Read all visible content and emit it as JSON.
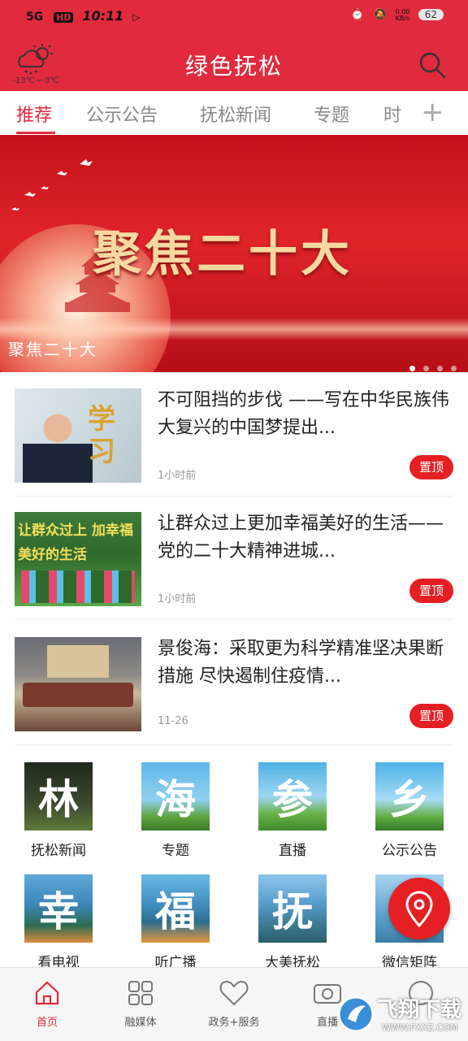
{
  "status_bar": {
    "network": "5G",
    "hd": "HD",
    "time": "10:11",
    "speed": "0.00\nKB/s",
    "battery": "62"
  },
  "header": {
    "title": "绿色抚松",
    "weather_temp": "-13℃~-3℃"
  },
  "tabs": [
    {
      "label": "推荐",
      "active": true
    },
    {
      "label": "公示公告",
      "active": false
    },
    {
      "label": "抚松新闻",
      "active": false
    },
    {
      "label": "专题",
      "active": false
    },
    {
      "label": "时",
      "active": false
    }
  ],
  "banner": {
    "headline": "聚焦二十大",
    "caption": "聚焦二十大",
    "dot_count": 4,
    "active_dot": 0
  },
  "news": [
    {
      "title": "不可阻挡的步伐 ——写在中华民族伟大复兴的中国梦提出...",
      "time": "1小时前",
      "pin": "置顶",
      "thumb_text": "学习"
    },
    {
      "title": "让群众过上更加幸福美好的生活——党的二十大精神进城...",
      "time": "1小时前",
      "pin": "置顶",
      "thumb_text": "让群众过上 加幸福美好的生活"
    },
    {
      "title": "景俊海：采取更为科学精准坚决果断措施 尽快遏制住疫情...",
      "time": "11-26",
      "pin": "置顶",
      "thumb_text": ""
    }
  ],
  "grid": [
    {
      "char": "林",
      "label": "抚松新闻"
    },
    {
      "char": "海",
      "label": "专题"
    },
    {
      "char": "参",
      "label": "直播"
    },
    {
      "char": "乡",
      "label": "公示公告"
    },
    {
      "char": "幸",
      "label": "看电视"
    },
    {
      "char": "福",
      "label": "听广播"
    },
    {
      "char": "抚",
      "label": "大美抚松"
    },
    {
      "char": "",
      "label": "微信矩阵"
    }
  ],
  "tabbar": [
    {
      "label": "首页",
      "icon": "home-icon",
      "active": true
    },
    {
      "label": "融媒体",
      "icon": "grid-icon",
      "active": false
    },
    {
      "label": "政务+服务",
      "icon": "heart-icon",
      "active": false
    },
    {
      "label": "直播",
      "icon": "camera-icon",
      "active": false
    },
    {
      "label": "",
      "icon": "profile-icon",
      "active": false
    }
  ],
  "watermark": {
    "title": "飞翔下载",
    "url": "WWW.FXXZ.COM"
  },
  "colors": {
    "brand_red": "#e12a3d",
    "pin_red": "#e51f23"
  }
}
